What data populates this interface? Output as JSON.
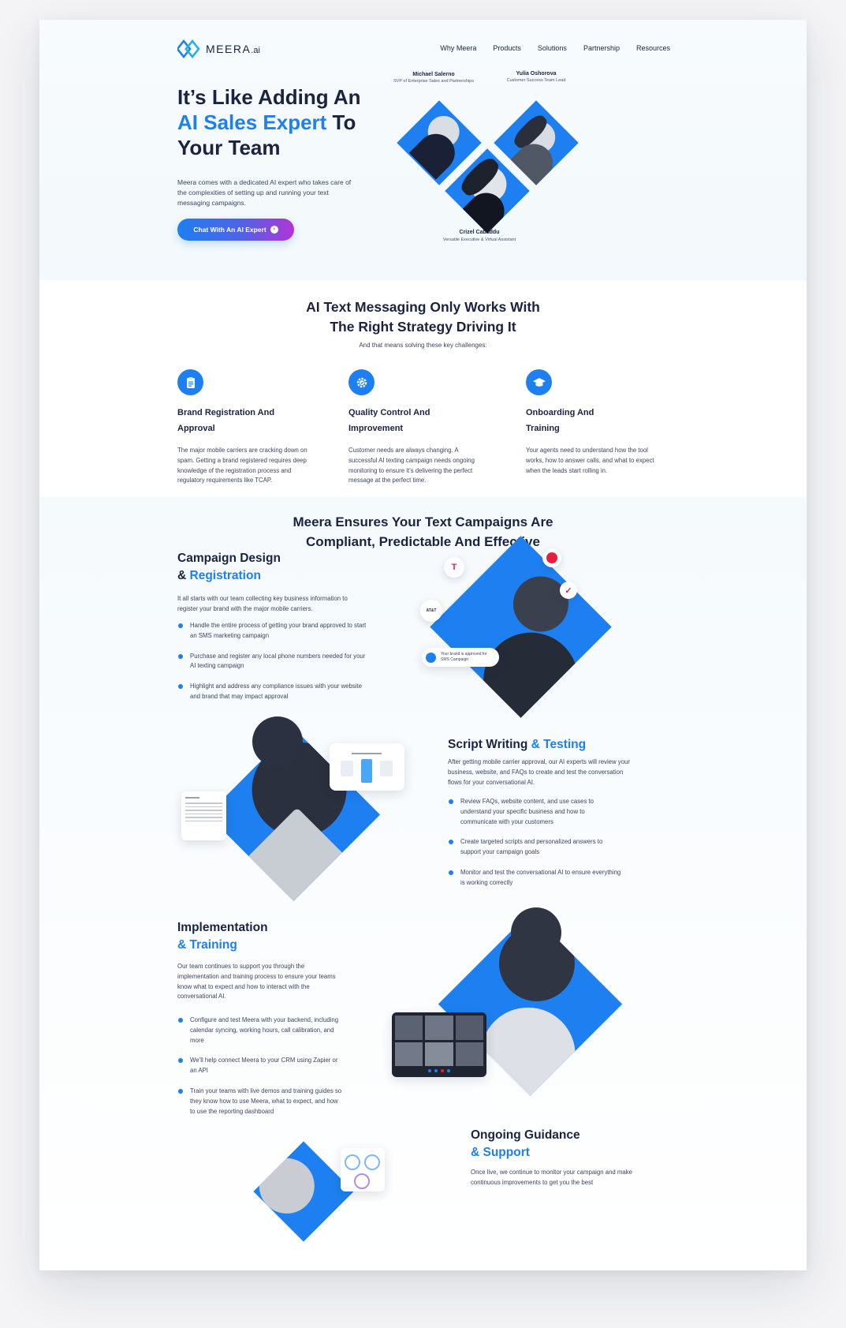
{
  "brand": {
    "name": "MEERA",
    "suffix": ".ai",
    "accent": "#1e80f0",
    "dark": "#1a2340"
  },
  "nav": {
    "items": [
      "Why Meera",
      "Products",
      "Solutions",
      "Partnership",
      "Resources"
    ]
  },
  "hero": {
    "title_line1": "It’s Like Adding An",
    "title_highlight": "AI Sales Expert",
    "title_mid": " To",
    "title_line3": "Your Team",
    "description": "Meera comes with a dedicated AI expert who takes care of the complexities of setting up and running your text messaging campaigns.",
    "cta_label": "Chat With An AI Expert",
    "people": [
      {
        "name": "Michael Salerno",
        "role": "SVP of Enterprise Sales and Partnerships"
      },
      {
        "name": "Yulia Oshorova",
        "role": "Customer Success Team Lead"
      },
      {
        "name": "Crizel Cabaddu",
        "role": "Versatile Executive & Virtual Assistant"
      }
    ]
  },
  "challenges": {
    "title_line1": "AI Text Messaging Only Works With",
    "title_line2": "The Right Strategy Driving It",
    "subtitle": "And that means solving these key challenges:",
    "items": [
      {
        "icon": "clipboard-icon",
        "title": "Brand Registration And Approval",
        "text": "The major mobile carriers are cracking down on spam. Getting a brand registered requires deep knowledge of the registration process and regulatory requirements like TCAP."
      },
      {
        "icon": "gear-check-icon",
        "title": "Quality Control And Improvement",
        "text": "Customer needs are always changing. A successful AI texting campaign needs ongoing monitoring to ensure it’s delivering the perfect message at the perfect time."
      },
      {
        "icon": "graduation-cap-icon",
        "title": "Onboarding And Training",
        "text": "Your agents need to understand how the tool works, how to answer calls, and what to expect when the leads start rolling in."
      }
    ]
  },
  "ensures": {
    "title_line1": "Meera Ensures Your Text Campaigns Are",
    "title_line2": "Compliant, Predictable And Effective"
  },
  "campaign": {
    "title_line1": "Campaign Design",
    "title_amp": "& ",
    "title_highlight": "Registration",
    "description": "It all starts with our team collecting key business information to register your brand with the major mobile carriers.",
    "bullets": [
      "Handle the entire process of getting your brand approved to start an SMS marketing campaign",
      "Purchase and register any local phone numbers needed for your AI texting campaign",
      "Highlight and address any compliance issues with your website and brand that may impact approval"
    ],
    "carrier_tmobile": "T",
    "carrier_att": "AT&T",
    "approved_text": "Your brand is approved for SMS Campaign"
  },
  "script": {
    "title": "Script Writing ",
    "title_highlight": "& Testing",
    "description": "After getting mobile carrier approval, our AI experts will review your business, website, and FAQs to create and test the conversation flows for your conversational AI.",
    "bullets": [
      "Review FAQs, website content, and use cases to understand your specific business and how to communicate with your customers",
      "Create targeted scripts and personalized answers to support your campaign goals",
      "Monitor and test the conversational AI to ensure everything is working correctly"
    ]
  },
  "implementation": {
    "title_line1": "Implementation",
    "title_highlight": "& Training",
    "description": "Our team continues to support you through the implementation and training process to ensure your teams know what to expect and how to interact with the conversational AI.",
    "bullets": [
      "Configure and test Meera with your backend, including calendar syncing, working hours, call calibration, and more",
      "We’ll help connect Meera to your CRM using Zapier or an API",
      "Train your teams with live demos and training guides so they know how to use Meera, what to expect, and how to use the reporting dashboard"
    ]
  },
  "guidance": {
    "title_line1": "Ongoing Guidance",
    "title_highlight": "& Support",
    "description": "Once live, we continue to monitor your campaign and make continuous improvements to get you the best"
  }
}
